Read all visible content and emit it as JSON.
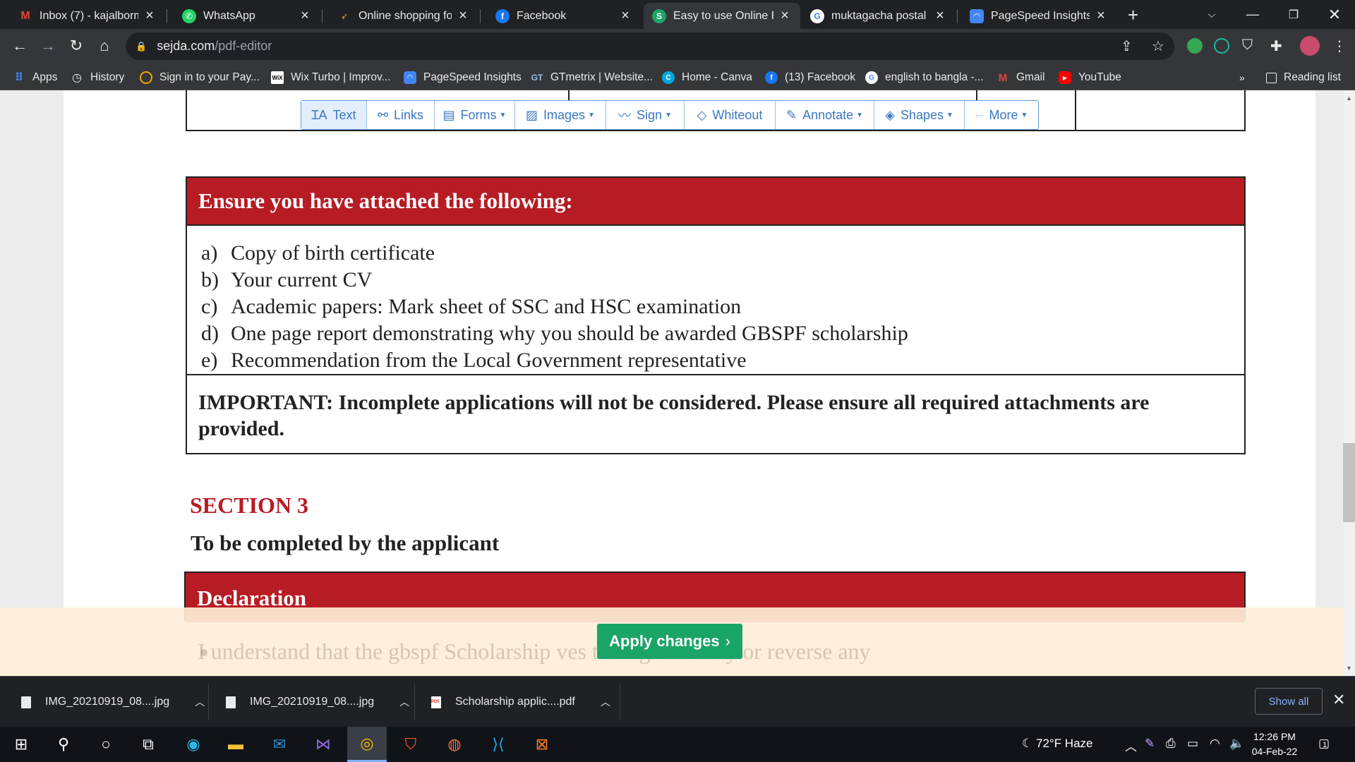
{
  "tabs": [
    {
      "title": "Inbox (7) - kajalborm",
      "icon": "gmail-icon",
      "color": "#ea4335"
    },
    {
      "title": "WhatsApp",
      "icon": "whatsapp-icon",
      "color": "#25d366"
    },
    {
      "title": "Online shopping for A",
      "icon": "shopping-icon",
      "color": "#f5a623"
    },
    {
      "title": "Facebook",
      "icon": "facebook-icon",
      "color": "#1877f2"
    },
    {
      "title": "Easy to use Online PD",
      "icon": "sejda-icon",
      "color": "#1aa567",
      "active": true
    },
    {
      "title": "muktagacha postal co",
      "icon": "google-icon",
      "color": "#4285f4"
    },
    {
      "title": "PageSpeed Insights",
      "icon": "pagespeed-icon",
      "color": "#4285f4"
    }
  ],
  "address": {
    "domain": "sejda.com",
    "path": "/pdf-editor"
  },
  "bookmarks": [
    {
      "label": "Apps",
      "icon": "apps-grid-icon",
      "color": "#4285f4"
    },
    {
      "label": "History",
      "icon": "history-icon",
      "color": "#5f6368"
    },
    {
      "label": "Sign in to your Pay...",
      "icon": "payoneer-icon",
      "color": "#f0a500"
    },
    {
      "label": "Wix Turbo | Improv...",
      "icon": "wix-icon",
      "color": "#ffffff"
    },
    {
      "label": "PageSpeed Insights",
      "icon": "pagespeed-icon",
      "color": "#4285f4"
    },
    {
      "label": "GTmetrix | Website...",
      "icon": "gtmetrix-icon",
      "color": "#1b4e8c"
    },
    {
      "label": "Home - Canva",
      "icon": "canva-icon",
      "color": "#00c4cc"
    },
    {
      "label": "(13) Facebook",
      "icon": "facebook-icon",
      "color": "#1877f2"
    },
    {
      "label": "english to bangla -...",
      "icon": "google-icon",
      "color": "#4285f4"
    },
    {
      "label": "Gmail",
      "icon": "gmail-icon",
      "color": "#ea4335"
    },
    {
      "label": "YouTube",
      "icon": "youtube-icon",
      "color": "#ff0000"
    }
  ],
  "reading_list": "Reading list",
  "editor_toolbar": [
    {
      "label": "Text",
      "icon": "text-tool-icon",
      "glyph": "ꞮA",
      "dropdown": false,
      "active": true
    },
    {
      "label": "Links",
      "icon": "link-icon",
      "glyph": "🔗",
      "dropdown": false
    },
    {
      "label": "Forms",
      "icon": "forms-icon",
      "glyph": "▤",
      "dropdown": true
    },
    {
      "label": "Images",
      "icon": "image-icon",
      "glyph": "▨",
      "dropdown": true
    },
    {
      "label": "Sign",
      "icon": "signature-icon",
      "glyph": "✍",
      "dropdown": true
    },
    {
      "label": "Whiteout",
      "icon": "eraser-icon",
      "glyph": "◇",
      "dropdown": false
    },
    {
      "label": "Annotate",
      "icon": "pen-icon",
      "glyph": "✎",
      "dropdown": true
    },
    {
      "label": "Shapes",
      "icon": "shapes-icon",
      "glyph": "◈",
      "dropdown": true
    },
    {
      "label": "More",
      "icon": "more-icon",
      "glyph": "···",
      "dropdown": true
    }
  ],
  "document": {
    "attach_heading": "Ensure you have attached the following:",
    "attachments": [
      {
        "letter": "a)",
        "text": "Copy of birth certificate"
      },
      {
        "letter": "b)",
        "text": "Your current CV"
      },
      {
        "letter": "c)",
        "text": "Academic papers: Mark sheet of SSC and HSC examination"
      },
      {
        "letter": "d)",
        "text": "One page report demonstrating why you should be awarded GBSPF scholarship"
      },
      {
        "letter": "e)",
        "text": "Recommendation from the Local Government representative"
      }
    ],
    "important": "IMPORTANT: Incomplete applications will not be considered. Please ensure all required attachments are provided.",
    "section_title": "SECTION 3",
    "section_subtitle": "To be completed by the applicant",
    "declaration_heading": "Declaration",
    "declaration_partial": "I understand that the gbspf Scholarship                          ves the right to vary or reverse any"
  },
  "apply_button": "Apply changes",
  "downloads": [
    {
      "name": "IMG_20210919_08....jpg",
      "type": "image"
    },
    {
      "name": "IMG_20210919_08....jpg",
      "type": "image"
    },
    {
      "name": "Scholarship applic....pdf",
      "type": "pdf"
    }
  ],
  "show_all": "Show all",
  "taskbar": {
    "weather": "72°F  Haze",
    "time": "12:26 PM",
    "date": "04-Feb-22",
    "notifications": "1"
  }
}
